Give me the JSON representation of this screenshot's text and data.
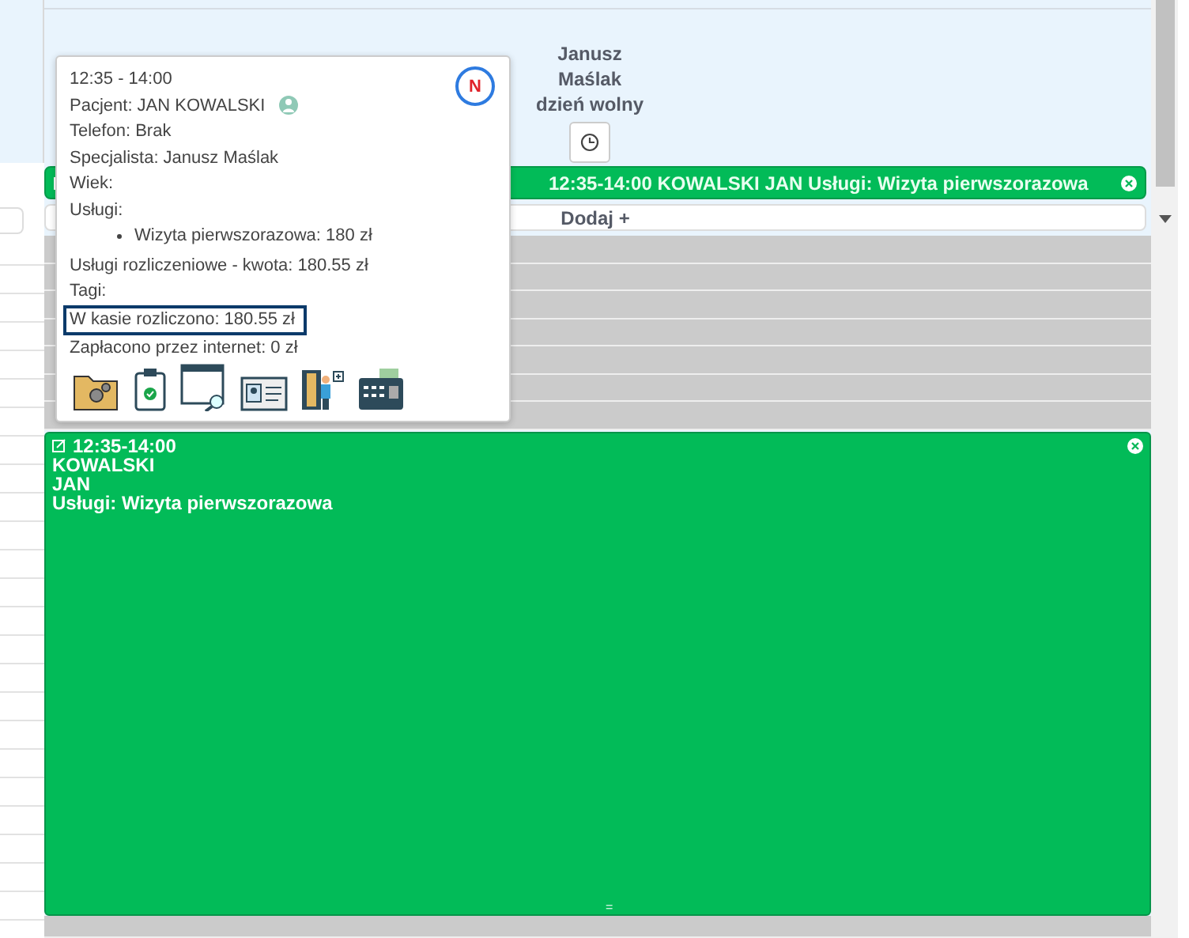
{
  "specialist_header": {
    "title": "Janusz Maślak dzień wolny"
  },
  "banner": {
    "text": "12:35-14:00 KOWALSKI JAN Usługi: Wizyta pierwszorazowa"
  },
  "add_button": {
    "label": "Dodaj +"
  },
  "popover": {
    "time": "12:35 - 14:00",
    "patient": "Pacjent: JAN KOWALSKI",
    "phone": "Telefon: Brak",
    "specialist": "Specjalista: Janusz Maślak",
    "age": "Wiek:",
    "services_label": "Usługi:",
    "services": [
      "Wizyta pierwszorazowa: 180 zł"
    ],
    "billing": "Usługi rozliczeniowe - kwota: 180.55 zł",
    "tags": "Tagi:",
    "cash": "W kasie rozliczono: 180.55 zł",
    "online": "Zapłacono przez internet: 0 zł",
    "badge": "N"
  },
  "event": {
    "time": "12:35-14:00",
    "lines": [
      "KOWALSKI",
      "JAN",
      "Usługi: Wizyta pierwszorazowa"
    ],
    "handle": "="
  }
}
